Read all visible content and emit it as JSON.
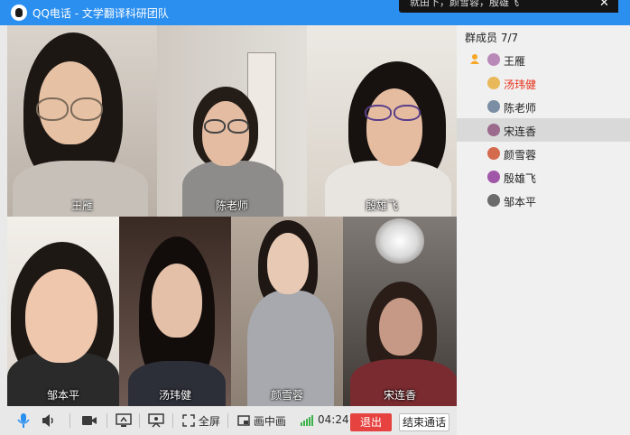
{
  "window": {
    "title": "QQ电话 - 文学翻译科研团队"
  },
  "notification": {
    "text": "就由下，颜雪蓉，殷雄飞"
  },
  "video_tiles": [
    {
      "name": "王雁"
    },
    {
      "name": "陈老师"
    },
    {
      "name": "殷雄飞"
    },
    {
      "name": "邹本平"
    },
    {
      "name": "汤玮健"
    },
    {
      "name": "颜雪蓉"
    },
    {
      "name": "宋连香"
    }
  ],
  "sidebar": {
    "count_label": "群成员 7/7",
    "members": [
      {
        "name": "王雁",
        "highlight": false,
        "selected": false
      },
      {
        "name": "汤玮健",
        "highlight": true,
        "selected": false
      },
      {
        "name": "陈老师",
        "highlight": false,
        "selected": false
      },
      {
        "name": "宋连香",
        "highlight": false,
        "selected": true
      },
      {
        "name": "颜雪蓉",
        "highlight": false,
        "selected": false
      },
      {
        "name": "殷雄飞",
        "highlight": false,
        "selected": false
      },
      {
        "name": "邹本平",
        "highlight": false,
        "selected": false
      }
    ]
  },
  "toolbar": {
    "fullscreen_label": "全屏",
    "pip_label": "画中画",
    "timer": "04:24",
    "exit_label": "退出",
    "end_call_label": "结束通话"
  },
  "colors": {
    "titlebar": "#2b8ff0",
    "exit": "#e64340",
    "highlight_member": "#e8341c",
    "signal": "#3bb34a"
  }
}
